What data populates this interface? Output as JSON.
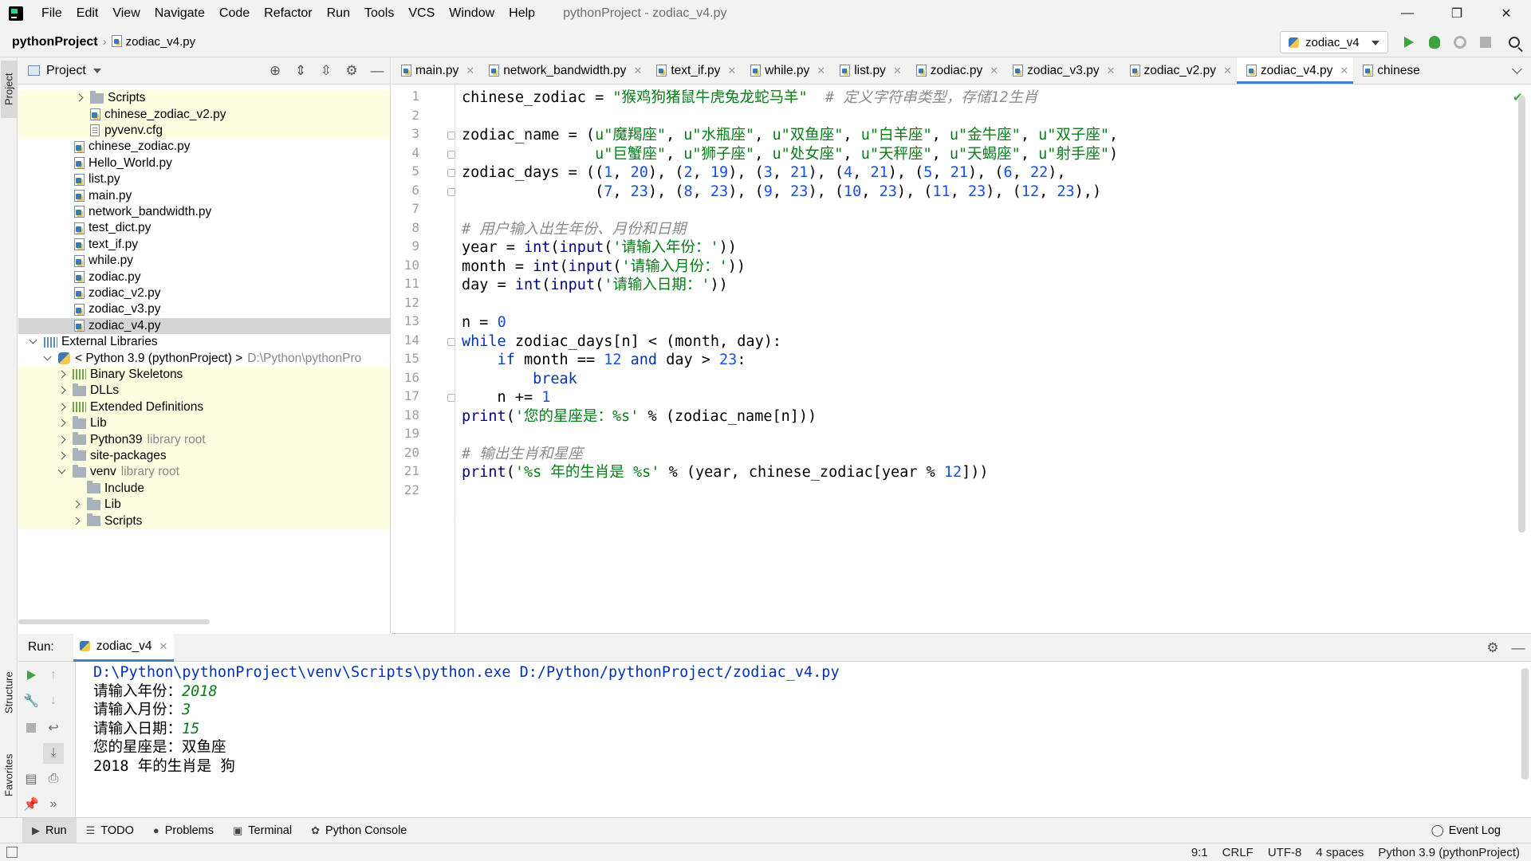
{
  "menubar": {
    "items": [
      "File",
      "Edit",
      "View",
      "Navigate",
      "Code",
      "Refactor",
      "Run",
      "Tools",
      "VCS",
      "Window",
      "Help"
    ],
    "window_title": "pythonProject - zodiac_v4.py",
    "minimize": "—",
    "maximize": "❐",
    "close": "✕"
  },
  "navbar": {
    "project": "pythonProject",
    "file": "zodiac_v4.py",
    "run_config": "zodiac_v4"
  },
  "left_strip": {
    "project_tab": "Project",
    "structure_tab": "Structure",
    "favorites_tab": "Favorites"
  },
  "project_panel": {
    "title": "Project",
    "tree": [
      {
        "label": "Scripts",
        "kind": "folder",
        "arrow": "right",
        "yellow": true
      },
      {
        "label": "chinese_zodiac_v2.py",
        "kind": "py",
        "yellow": true
      },
      {
        "label": "pyvenv.cfg",
        "kind": "cfg",
        "yellow": true
      },
      {
        "label": "chinese_zodiac.py",
        "kind": "py"
      },
      {
        "label": "Hello_World.py",
        "kind": "py"
      },
      {
        "label": "list.py",
        "kind": "py"
      },
      {
        "label": "main.py",
        "kind": "py"
      },
      {
        "label": "network_bandwidth.py",
        "kind": "py"
      },
      {
        "label": "test_dict.py",
        "kind": "py"
      },
      {
        "label": "text_if.py",
        "kind": "py"
      },
      {
        "label": "while.py",
        "kind": "py"
      },
      {
        "label": "zodiac.py",
        "kind": "py"
      },
      {
        "label": "zodiac_v2.py",
        "kind": "py"
      },
      {
        "label": "zodiac_v3.py",
        "kind": "py"
      },
      {
        "label": "zodiac_v4.py",
        "kind": "py",
        "selected": true
      },
      {
        "label": "External Libraries",
        "kind": "lib",
        "arrow": "down"
      },
      {
        "label": "< Python 3.9 (pythonProject) >",
        "hint": "D:\\Python\\pythonPro",
        "kind": "python",
        "arrow": "down"
      },
      {
        "label": "Binary Skeletons",
        "kind": "lib-green",
        "arrow": "right",
        "yellow": true
      },
      {
        "label": "DLLs",
        "kind": "folder",
        "arrow": "right",
        "yellow": true
      },
      {
        "label": "Extended Definitions",
        "kind": "lib-green",
        "arrow": "right",
        "yellow": true
      },
      {
        "label": "Lib",
        "kind": "folder",
        "arrow": "right",
        "yellow": true
      },
      {
        "label": "Python39",
        "hint": "library root",
        "kind": "folder",
        "arrow": "right",
        "yellow": true
      },
      {
        "label": "site-packages",
        "kind": "folder",
        "arrow": "right",
        "yellow": true
      },
      {
        "label": "venv",
        "hint": "library root",
        "kind": "folder",
        "arrow": "down",
        "yellow": true
      },
      {
        "label": "Include",
        "kind": "folder",
        "yellow": true
      },
      {
        "label": "Lib",
        "kind": "folder",
        "arrow": "right",
        "yellow": true
      },
      {
        "label": "Scripts",
        "kind": "folder",
        "arrow": "right",
        "yellow": true
      }
    ]
  },
  "editor": {
    "tabs": [
      {
        "label": "main.py"
      },
      {
        "label": "network_bandwidth.py"
      },
      {
        "label": "text_if.py"
      },
      {
        "label": "while.py"
      },
      {
        "label": "list.py"
      },
      {
        "label": "zodiac.py"
      },
      {
        "label": "zodiac_v3.py"
      },
      {
        "label": "zodiac_v2.py"
      },
      {
        "label": "zodiac_v4.py",
        "active": true
      },
      {
        "label": "chinese"
      }
    ],
    "line_numbers": [
      "1",
      "2",
      "3",
      "4",
      "5",
      "6",
      "7",
      "8",
      "9",
      "10",
      "11",
      "12",
      "13",
      "14",
      "15",
      "16",
      "17",
      "18",
      "19",
      "20",
      "21",
      "22"
    ],
    "lines": [
      [
        [
          "chinese_zodiac = ",
          ""
        ],
        [
          "\"猴鸡狗猪鼠牛虎兔龙蛇马羊\"",
          "str"
        ],
        [
          "  ",
          ""
        ],
        [
          "# 定义字符串类型，存储12生肖",
          "cmt"
        ]
      ],
      [],
      [
        [
          "zodiac_name = (",
          ""
        ],
        [
          "u\"魔羯座\"",
          "str"
        ],
        [
          ", ",
          ""
        ],
        [
          "u\"水瓶座\"",
          "str"
        ],
        [
          ", ",
          ""
        ],
        [
          "u\"双鱼座\"",
          "str"
        ],
        [
          ", ",
          ""
        ],
        [
          "u\"白羊座\"",
          "str"
        ],
        [
          ", ",
          ""
        ],
        [
          "u\"金牛座\"",
          "str"
        ],
        [
          ", ",
          ""
        ],
        [
          "u\"双子座\"",
          "str"
        ],
        [
          ",",
          ""
        ]
      ],
      [
        [
          "               ",
          ""
        ],
        [
          "u\"巨蟹座\"",
          "str"
        ],
        [
          ", ",
          ""
        ],
        [
          "u\"狮子座\"",
          "str"
        ],
        [
          ", ",
          ""
        ],
        [
          "u\"处女座\"",
          "str"
        ],
        [
          ", ",
          ""
        ],
        [
          "u\"天秤座\"",
          "str"
        ],
        [
          ", ",
          ""
        ],
        [
          "u\"天蝎座\"",
          "str"
        ],
        [
          ", ",
          ""
        ],
        [
          "u\"射手座\"",
          "str"
        ],
        [
          ")",
          ""
        ]
      ],
      [
        [
          "zodiac_days = ((",
          ""
        ],
        [
          "1",
          "num"
        ],
        [
          ", ",
          ""
        ],
        [
          "20",
          "num"
        ],
        [
          "), (",
          ""
        ],
        [
          "2",
          "num"
        ],
        [
          ", ",
          ""
        ],
        [
          "19",
          "num"
        ],
        [
          "), (",
          ""
        ],
        [
          "3",
          "num"
        ],
        [
          ", ",
          ""
        ],
        [
          "21",
          "num"
        ],
        [
          "), (",
          ""
        ],
        [
          "4",
          "num"
        ],
        [
          ", ",
          ""
        ],
        [
          "21",
          "num"
        ],
        [
          "), (",
          ""
        ],
        [
          "5",
          "num"
        ],
        [
          ", ",
          ""
        ],
        [
          "21",
          "num"
        ],
        [
          "), (",
          ""
        ],
        [
          "6",
          "num"
        ],
        [
          ", ",
          ""
        ],
        [
          "22",
          "num"
        ],
        [
          "),",
          ""
        ]
      ],
      [
        [
          "               (",
          ""
        ],
        [
          "7",
          "num"
        ],
        [
          ", ",
          ""
        ],
        [
          "23",
          "num"
        ],
        [
          "), (",
          ""
        ],
        [
          "8",
          "num"
        ],
        [
          ", ",
          ""
        ],
        [
          "23",
          "num"
        ],
        [
          "), (",
          ""
        ],
        [
          "9",
          "num"
        ],
        [
          ", ",
          ""
        ],
        [
          "23",
          "num"
        ],
        [
          "), (",
          ""
        ],
        [
          "10",
          "num"
        ],
        [
          ", ",
          ""
        ],
        [
          "23",
          "num"
        ],
        [
          "), (",
          ""
        ],
        [
          "11",
          "num"
        ],
        [
          ", ",
          ""
        ],
        [
          "23",
          "num"
        ],
        [
          "), (",
          ""
        ],
        [
          "12",
          "num"
        ],
        [
          ", ",
          ""
        ],
        [
          "23",
          "num"
        ],
        [
          "),)",
          ""
        ]
      ],
      [],
      [
        [
          "# 用户输入出生年份、月份和日期",
          "cmt"
        ]
      ],
      [
        [
          "year = ",
          ""
        ],
        [
          "int",
          "bi"
        ],
        [
          "(",
          ""
        ],
        [
          "input",
          "bi"
        ],
        [
          "(",
          ""
        ],
        [
          "'请输入年份：'",
          "str"
        ],
        [
          "))",
          ""
        ]
      ],
      [
        [
          "month = ",
          ""
        ],
        [
          "int",
          "bi"
        ],
        [
          "(",
          ""
        ],
        [
          "input",
          "bi"
        ],
        [
          "(",
          ""
        ],
        [
          "'请输入月份：'",
          "str"
        ],
        [
          "))",
          ""
        ]
      ],
      [
        [
          "day = ",
          ""
        ],
        [
          "int",
          "bi"
        ],
        [
          "(",
          ""
        ],
        [
          "input",
          "bi"
        ],
        [
          "(",
          ""
        ],
        [
          "'请输入日期：'",
          "str"
        ],
        [
          "))",
          ""
        ]
      ],
      [],
      [
        [
          "n = ",
          ""
        ],
        [
          "0",
          "num"
        ]
      ],
      [
        [
          "while",
          "kw"
        ],
        [
          " zodiac_days[n] < (month, day):",
          ""
        ]
      ],
      [
        [
          "    ",
          ""
        ],
        [
          "if",
          "kw"
        ],
        [
          " month == ",
          ""
        ],
        [
          "12",
          "num"
        ],
        [
          " ",
          ""
        ],
        [
          "and",
          "kw"
        ],
        [
          " day > ",
          ""
        ],
        [
          "23",
          "num"
        ],
        [
          ":",
          ""
        ]
      ],
      [
        [
          "        ",
          ""
        ],
        [
          "break",
          "kw"
        ]
      ],
      [
        [
          "    n += ",
          ""
        ],
        [
          "1",
          "num"
        ]
      ],
      [
        [
          "print",
          "bi"
        ],
        [
          "(",
          ""
        ],
        [
          "'您的星座是：%s'",
          "str"
        ],
        [
          " % (zodiac_name[n]))",
          ""
        ]
      ],
      [],
      [
        [
          "# 输出生肖和星座",
          "cmt"
        ]
      ],
      [
        [
          "print",
          "bi"
        ],
        [
          "(",
          ""
        ],
        [
          "'%s 年的生肖是 %s'",
          "str"
        ],
        [
          " % (year, chinese_zodiac[year % ",
          ""
        ],
        [
          "12",
          "num"
        ],
        [
          "]))",
          ""
        ]
      ],
      []
    ]
  },
  "run_panel": {
    "label": "Run:",
    "tab": "zodiac_v4",
    "console": [
      [
        [
          "D:\\Python\\pythonProject\\venv\\Scripts\\python.exe D:/Python/pythonProject/zodiac_v4.py",
          "con-cmd"
        ]
      ],
      [
        [
          "请输入年份：",
          ""
        ],
        [
          "2018",
          "con-input"
        ]
      ],
      [
        [
          "请输入月份：",
          ""
        ],
        [
          "3",
          "con-input"
        ]
      ],
      [
        [
          "请输入日期：",
          ""
        ],
        [
          "15",
          "con-input"
        ]
      ],
      [
        [
          "您的星座是：双鱼座",
          ""
        ]
      ],
      [
        [
          "2018 年的生肖是 狗",
          ""
        ]
      ]
    ]
  },
  "bottom_tools": {
    "run": "Run",
    "todo": "TODO",
    "problems": "Problems",
    "terminal": "Terminal",
    "python_console": "Python Console",
    "event_log": "Event Log"
  },
  "status": {
    "position": "9:1",
    "line_sep": "CRLF",
    "encoding": "UTF-8",
    "indent": "4 spaces",
    "interpreter": "Python 3.9 (pythonProject)"
  },
  "colors": {
    "keyword": "#0033b3",
    "string": "#067d17",
    "number": "#1750eb",
    "comment": "#8c8c8c",
    "accent": "#4083c9"
  }
}
